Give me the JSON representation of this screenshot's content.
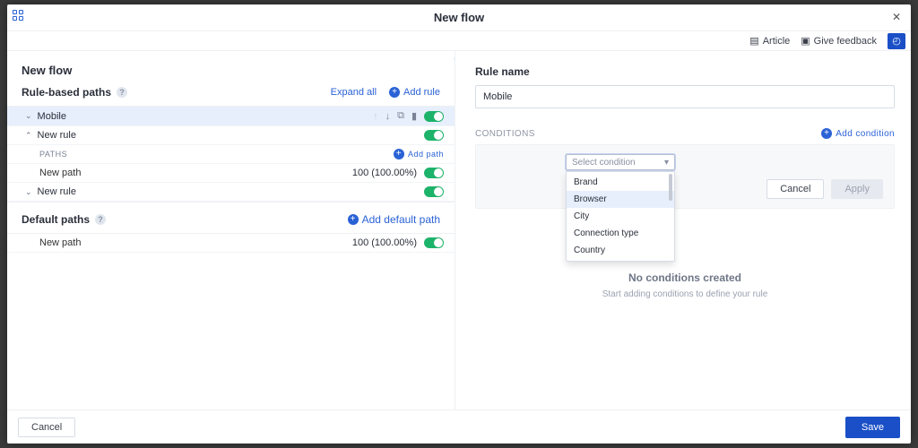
{
  "modal": {
    "title": "New flow"
  },
  "toolbar": {
    "article": "Article",
    "feedback": "Give feedback"
  },
  "left": {
    "heading": "New flow",
    "ruleBased": {
      "label": "Rule-based paths",
      "expandAll": "Expand all",
      "addRule": "Add rule"
    },
    "rules": [
      {
        "name": "Mobile",
        "expanded": true,
        "selected": true
      },
      {
        "name": "New rule",
        "expanded": false
      },
      {
        "name": "New rule",
        "expanded": true
      }
    ],
    "pathsHeader": "PATHS",
    "addPath": "Add path",
    "pathRow": {
      "name": "New path",
      "pct": "100 (100.00%)"
    },
    "defaultPaths": {
      "label": "Default paths",
      "addDefault": "Add default path"
    },
    "defaultRow": {
      "name": "New path",
      "pct": "100 (100.00%)"
    }
  },
  "right": {
    "ruleNameLabel": "Rule name",
    "ruleNameValue": "Mobile",
    "conditionsLabel": "CONDITIONS",
    "addCondition": "Add condition",
    "selectPlaceholder": "Select condition",
    "options": [
      "Brand",
      "Browser",
      "City",
      "Connection type",
      "Country"
    ],
    "highlightIndex": 1,
    "cancel": "Cancel",
    "apply": "Apply",
    "empty": {
      "title": "No conditions created",
      "sub": "Start adding conditions to define your rule"
    }
  },
  "footer": {
    "cancel": "Cancel",
    "save": "Save"
  }
}
